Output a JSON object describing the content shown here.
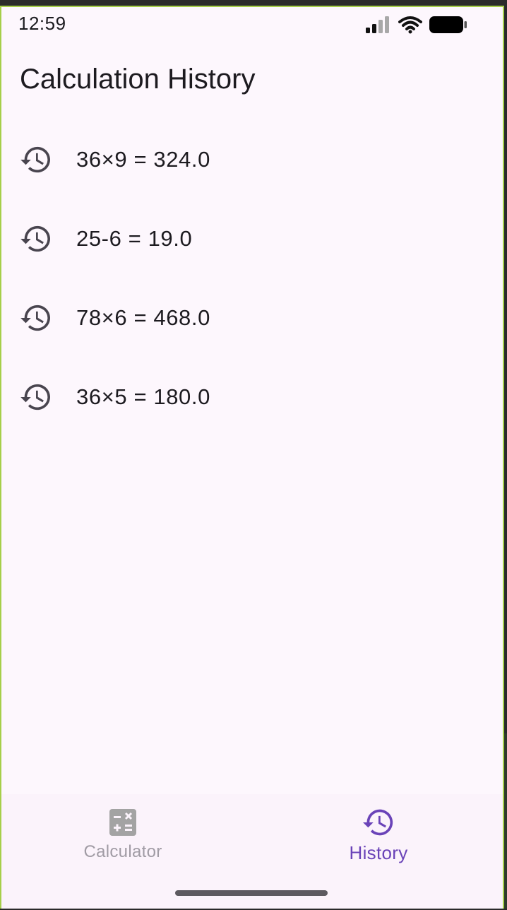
{
  "status_bar": {
    "time": "12:59",
    "icons": [
      "signal-icon",
      "wifi-icon",
      "battery-icon"
    ]
  },
  "page": {
    "title": "Calculation History"
  },
  "history": [
    {
      "expression": "36×9 = 324.0",
      "icon": "history-icon"
    },
    {
      "expression": "25-6 = 19.0",
      "icon": "history-icon"
    },
    {
      "expression": "78×6 = 468.0",
      "icon": "history-icon"
    },
    {
      "expression": "36×5 = 180.0",
      "icon": "history-icon"
    }
  ],
  "bottom_nav": {
    "items": [
      {
        "label": "Calculator",
        "icon": "calculator-icon",
        "selected": false
      },
      {
        "label": "History",
        "icon": "history-icon",
        "selected": true
      }
    ]
  },
  "colors": {
    "background": "#fdf7fd",
    "accent": "#6a43b8",
    "inactive": "#a09ba4",
    "text": "#1d1b20"
  }
}
